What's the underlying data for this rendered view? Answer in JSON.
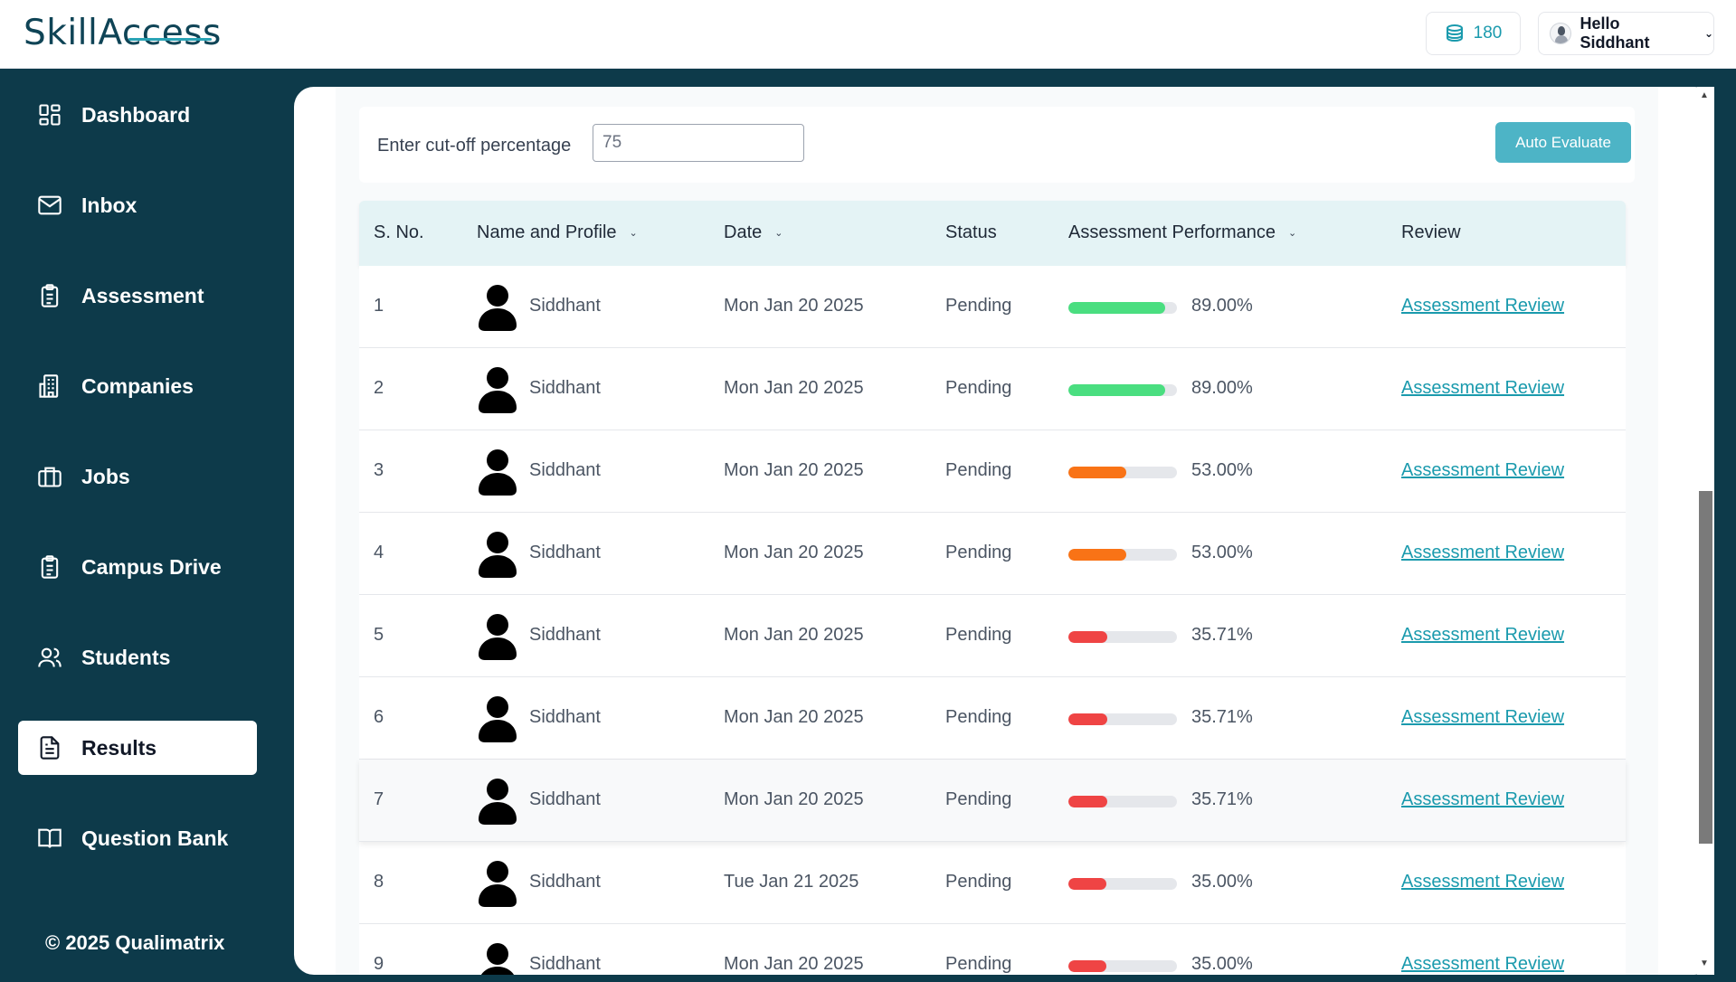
{
  "app": {
    "logo_part1": "Skill",
    "logo_part2": "Access"
  },
  "header": {
    "coins": "180",
    "greeting": "Hello Siddhant"
  },
  "sidebar": {
    "items": [
      {
        "label": "Dashboard",
        "icon": "dashboard-icon"
      },
      {
        "label": "Inbox",
        "icon": "mail-icon"
      },
      {
        "label": "Assessment",
        "icon": "clipboard-icon"
      },
      {
        "label": "Companies",
        "icon": "building-icon"
      },
      {
        "label": "Jobs",
        "icon": "briefcase-icon"
      },
      {
        "label": "Campus Drive",
        "icon": "clipboard-list-icon"
      },
      {
        "label": "Students",
        "icon": "users-icon"
      },
      {
        "label": "Results",
        "icon": "document-icon",
        "active": true
      },
      {
        "label": "Question Bank",
        "icon": "book-icon"
      }
    ],
    "copyright": "© 2025 Qualimatrix"
  },
  "cutoff": {
    "label": "Enter cut-off percentage",
    "value": "75",
    "button": "Auto Evaluate"
  },
  "table": {
    "headers": [
      "S. No.",
      "Name and Profile",
      "Date",
      "Status",
      "Assessment Performance",
      "Review"
    ],
    "rows": [
      {
        "sno": "1",
        "name": "Siddhant",
        "date": "Mon Jan 20 2025",
        "status": "Pending",
        "percent": "89.00%",
        "fill": 0.89,
        "color": "#4ade80",
        "review": "Assessment Review"
      },
      {
        "sno": "2",
        "name": "Siddhant",
        "date": "Mon Jan 20 2025",
        "status": "Pending",
        "percent": "89.00%",
        "fill": 0.89,
        "color": "#4ade80",
        "review": "Assessment Review"
      },
      {
        "sno": "3",
        "name": "Siddhant",
        "date": "Mon Jan 20 2025",
        "status": "Pending",
        "percent": "53.00%",
        "fill": 0.53,
        "color": "#f97316",
        "review": "Assessment Review"
      },
      {
        "sno": "4",
        "name": "Siddhant",
        "date": "Mon Jan 20 2025",
        "status": "Pending",
        "percent": "53.00%",
        "fill": 0.53,
        "color": "#f97316",
        "review": "Assessment Review"
      },
      {
        "sno": "5",
        "name": "Siddhant",
        "date": "Mon Jan 20 2025",
        "status": "Pending",
        "percent": "35.71%",
        "fill": 0.3571,
        "color": "#ef4444",
        "review": "Assessment Review"
      },
      {
        "sno": "6",
        "name": "Siddhant",
        "date": "Mon Jan 20 2025",
        "status": "Pending",
        "percent": "35.71%",
        "fill": 0.3571,
        "color": "#ef4444",
        "review": "Assessment Review"
      },
      {
        "sno": "7",
        "name": "Siddhant",
        "date": "Mon Jan 20 2025",
        "status": "Pending",
        "percent": "35.71%",
        "fill": 0.3571,
        "color": "#ef4444",
        "review": "Assessment Review"
      },
      {
        "sno": "8",
        "name": "Siddhant",
        "date": "Tue Jan 21 2025",
        "status": "Pending",
        "percent": "35.00%",
        "fill": 0.35,
        "color": "#ef4444",
        "review": "Assessment Review"
      },
      {
        "sno": "9",
        "name": "Siddhant",
        "date": "Mon Jan 20 2025",
        "status": "Pending",
        "percent": "35.00%",
        "fill": 0.35,
        "color": "#ef4444",
        "review": "Assessment Review"
      }
    ]
  }
}
